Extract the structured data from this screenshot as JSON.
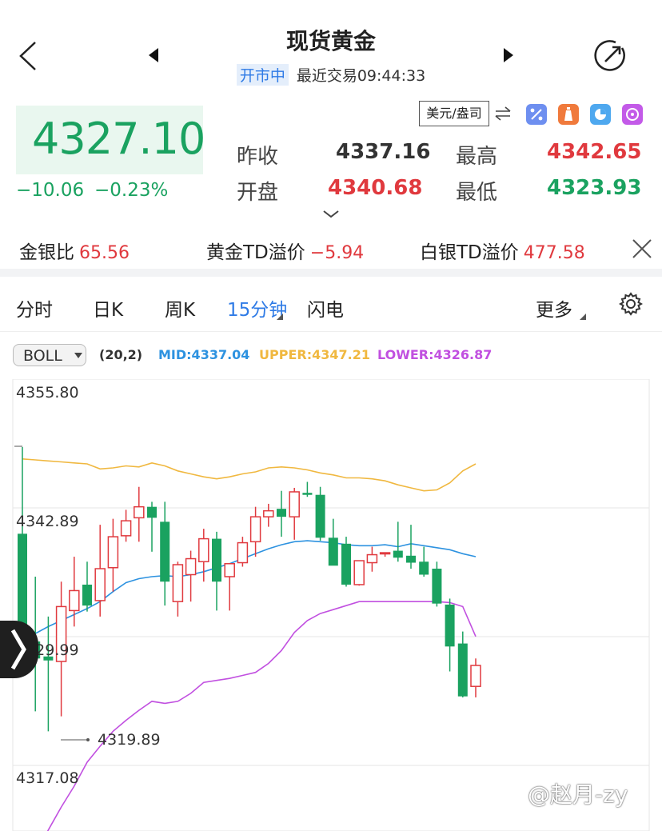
{
  "header": {
    "title": "现货黄金",
    "status_badge": "开市中",
    "last_trade": "最近交易09:44:33"
  },
  "quote": {
    "price": "4327.10",
    "change": "−10.06",
    "change_pct": "−0.23%",
    "unit": "美元/盎司",
    "prev_close_label": "昨收",
    "prev_close": "4337.16",
    "open_label": "开盘",
    "open": "4340.68",
    "high_label": "最高",
    "high": "4342.65",
    "low_label": "最低",
    "low": "4323.93"
  },
  "ratios": {
    "gs_label": "金银比",
    "gs_value": "65.56",
    "gold_td_label": "黄金TD溢价",
    "gold_td_value": "−5.94",
    "silver_td_label": "白银TD溢价",
    "silver_td_value": "477.58"
  },
  "tabs": {
    "t1": "分时",
    "t2": "日K",
    "t3": "周K",
    "t4": "15分钟",
    "t5": "闪电",
    "more": "更多"
  },
  "indicator": {
    "name": "BOLL",
    "params": "(20,2)",
    "mid": "MID:4337.04",
    "upper": "UPPER:4347.21",
    "lower": "LOWER:4326.87"
  },
  "axis": {
    "top": "4355.80",
    "upper_mid": "4342.89",
    "mid": "4329.99",
    "bottom": "4317.08",
    "low_marker": "4319.89"
  },
  "watermark": "@赵月-zy",
  "colors": {
    "up": "#e0393e",
    "down": "#1aa260",
    "mid_line": "#2d92e0",
    "upper_line": "#f0b840",
    "lower_line": "#c150e0",
    "accent": "#2f7be6"
  },
  "chart_data": {
    "type": "candlestick",
    "price_top": 4355.8,
    "price_bottom": 4317.08,
    "candles": [
      {
        "o": 4340.3,
        "h": 4349.0,
        "l": 4326.0,
        "c": 4330.5
      },
      {
        "o": 4329.5,
        "h": 4336.0,
        "l": 4322.5,
        "c": 4327.8
      },
      {
        "o": 4328.0,
        "h": 4332.0,
        "l": 4320.5,
        "c": 4327.6
      },
      {
        "o": 4327.5,
        "h": 4335.5,
        "l": 4322.0,
        "c": 4333.0
      },
      {
        "o": 4332.6,
        "h": 4338.0,
        "l": 4331.0,
        "c": 4334.6
      },
      {
        "o": 4335.2,
        "h": 4337.5,
        "l": 4332.5,
        "c": 4333.1
      },
      {
        "o": 4333.6,
        "h": 4341.2,
        "l": 4332.0,
        "c": 4336.8
      },
      {
        "o": 4336.9,
        "h": 4341.8,
        "l": 4334.5,
        "c": 4340.0
      },
      {
        "o": 4340.1,
        "h": 4342.7,
        "l": 4339.5,
        "c": 4341.6
      },
      {
        "o": 4341.9,
        "h": 4345.0,
        "l": 4339.5,
        "c": 4343.0
      },
      {
        "o": 4343.0,
        "h": 4343.5,
        "l": 4338.5,
        "c": 4341.9
      },
      {
        "o": 4341.5,
        "h": 4343.5,
        "l": 4333.1,
        "c": 4335.5
      },
      {
        "o": 4333.5,
        "h": 4337.5,
        "l": 4332.0,
        "c": 4337.2
      },
      {
        "o": 4336.2,
        "h": 4338.6,
        "l": 4333.5,
        "c": 4337.8
      },
      {
        "o": 4337.5,
        "h": 4340.8,
        "l": 4335.5,
        "c": 4339.8
      },
      {
        "o": 4339.8,
        "h": 4340.5,
        "l": 4332.6,
        "c": 4335.5
      },
      {
        "o": 4336.0,
        "h": 4336.8,
        "l": 4332.6,
        "c": 4337.3
      },
      {
        "o": 4337.4,
        "h": 4340.0,
        "l": 4337.0,
        "c": 4339.4
      },
      {
        "o": 4339.5,
        "h": 4343.0,
        "l": 4338.0,
        "c": 4342.0
      },
      {
        "o": 4342.0,
        "h": 4343.3,
        "l": 4341.0,
        "c": 4342.6
      },
      {
        "o": 4342.8,
        "h": 4344.6,
        "l": 4340.0,
        "c": 4342.0
      },
      {
        "o": 4342.0,
        "h": 4344.9,
        "l": 4339.7,
        "c": 4344.5
      },
      {
        "o": 4344.4,
        "h": 4345.5,
        "l": 4344.0,
        "c": 4344.2
      },
      {
        "o": 4344.2,
        "h": 4345.0,
        "l": 4339.6,
        "c": 4339.9
      },
      {
        "o": 4339.9,
        "h": 4341.8,
        "l": 4337.2,
        "c": 4337.1
      },
      {
        "o": 4339.3,
        "h": 4340.0,
        "l": 4335.0,
        "c": 4335.2
      },
      {
        "o": 4335.2,
        "h": 4337.5,
        "l": 4335.1,
        "c": 4337.6
      },
      {
        "o": 4337.4,
        "h": 4339.0,
        "l": 4336.5,
        "c": 4338.2
      },
      {
        "o": 4338.4,
        "h": 4338.4,
        "l": 4338.0,
        "c": 4338.4
      },
      {
        "o": 4338.6,
        "h": 4341.5,
        "l": 4337.5,
        "c": 4337.9
      },
      {
        "o": 4338.1,
        "h": 4341.2,
        "l": 4336.8,
        "c": 4337.4
      },
      {
        "o": 4337.5,
        "h": 4339.0,
        "l": 4336.0,
        "c": 4336.2
      },
      {
        "o": 4336.8,
        "h": 4337.5,
        "l": 4333.0,
        "c": 4333.3
      },
      {
        "o": 4333.2,
        "h": 4333.8,
        "l": 4326.5,
        "c": 4329.0
      },
      {
        "o": 4329.3,
        "h": 4330.5,
        "l": 4323.9,
        "c": 4324.0
      },
      {
        "o": 4325.0,
        "h": 4327.8,
        "l": 4323.9,
        "c": 4327.1
      }
    ],
    "mid_series": [
      4329.8,
      4330.3,
      4331.0,
      4331.6,
      4332.2,
      4332.8,
      4333.5,
      4334.5,
      4335.4,
      4335.8,
      4336.0,
      4336.1,
      4336.0,
      4336.2,
      4336.5,
      4336.9,
      4337.3,
      4337.8,
      4338.3,
      4338.8,
      4339.2,
      4339.5,
      4339.6,
      4339.5,
      4339.4,
      4339.2,
      4339.1,
      4339.1,
      4339.2,
      4339.0,
      4339.3,
      4339.1,
      4338.9,
      4338.7,
      4338.3,
      4338.0
    ],
    "upper_series": [
      4347.8,
      4347.7,
      4347.6,
      4347.5,
      4347.4,
      4347.3,
      4346.8,
      4346.9,
      4347.1,
      4347.0,
      4347.4,
      4347.1,
      4346.6,
      4346.3,
      4346.0,
      4345.8,
      4346.0,
      4346.3,
      4346.5,
      4346.9,
      4347.0,
      4346.9,
      4346.7,
      4346.4,
      4346.2,
      4345.9,
      4345.9,
      4345.8,
      4345.6,
      4345.2,
      4344.9,
      4344.6,
      4344.7,
      4345.4,
      4346.6,
      4347.3
    ],
    "lower_series": [
      4306.5,
      4308.5,
      4310.6,
      4312.9,
      4315.0,
      4317.4,
      4319.0,
      4320.5,
      4321.6,
      4322.6,
      4323.5,
      4323.3,
      4323.5,
      4324.3,
      4325.4,
      4325.6,
      4325.8,
      4326.1,
      4326.4,
      4327.3,
      4328.6,
      4330.4,
      4331.6,
      4332.3,
      4332.7,
      4333.1,
      4333.5,
      4333.5,
      4333.5,
      4333.5,
      4333.5,
      4333.5,
      4333.5,
      4333.4,
      4333.0,
      4330.0
    ]
  }
}
